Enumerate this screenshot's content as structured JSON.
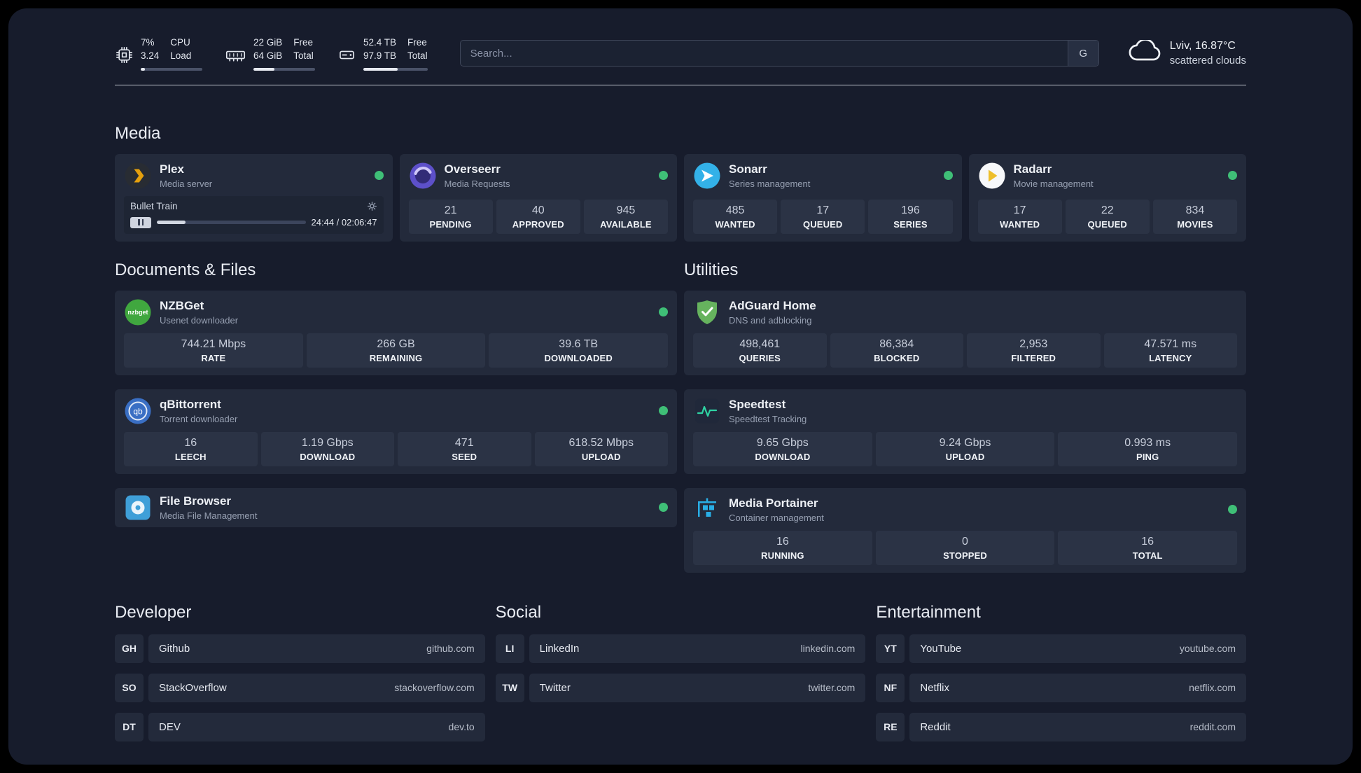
{
  "colors": {
    "status_online": "#3fbf77",
    "app_background": "#171c2c",
    "card_background": "#232a3b"
  },
  "topbar": {
    "cpu": {
      "icon": "cpu-icon",
      "value_line1": "7%",
      "value_line2": "3.24",
      "label_line1": "CPU",
      "label_line2": "Load",
      "bar_percent": 7
    },
    "memory": {
      "icon": "ram-icon",
      "value_line1": "22 GiB",
      "value_line2": "64 GiB",
      "label_line1": "Free",
      "label_line2": "Total",
      "bar_percent": 34
    },
    "storage": {
      "icon": "disk-icon",
      "value_line1": "52.4 TB",
      "value_line2": "97.9 TB",
      "label_line1": "Free",
      "label_line2": "Total",
      "bar_percent": 54
    },
    "search": {
      "placeholder": "Search...",
      "button_label": "G"
    },
    "weather": {
      "icon": "cloud-icon",
      "location": "Lviv, 16.87°C",
      "condition": "scattered clouds"
    }
  },
  "sections": {
    "media": "Media",
    "documents": "Documents & Files",
    "utilities": "Utilities",
    "developer": "Developer",
    "social": "Social",
    "entertainment": "Entertainment"
  },
  "apps": {
    "plex": {
      "name": "Plex",
      "desc": "Media server",
      "icon": "plex-icon",
      "status": "online",
      "player": {
        "track": "Bullet Train",
        "time": "24:44 / 02:06:47",
        "progress_percent": 19.5,
        "pause_icon": "pause-icon",
        "settings_icon": "gear-icon"
      }
    },
    "overseerr": {
      "name": "Overseerr",
      "desc": "Media Requests",
      "icon": "overseerr-icon",
      "status": "online",
      "stats": [
        {
          "value": "21",
          "label": "PENDING"
        },
        {
          "value": "40",
          "label": "APPROVED"
        },
        {
          "value": "945",
          "label": "AVAILABLE"
        }
      ]
    },
    "sonarr": {
      "name": "Sonarr",
      "desc": "Series management",
      "icon": "sonarr-icon",
      "status": "online",
      "stats": [
        {
          "value": "485",
          "label": "WANTED"
        },
        {
          "value": "17",
          "label": "QUEUED"
        },
        {
          "value": "196",
          "label": "SERIES"
        }
      ]
    },
    "radarr": {
      "name": "Radarr",
      "desc": "Movie management",
      "icon": "radarr-icon",
      "status": "online",
      "stats": [
        {
          "value": "17",
          "label": "WANTED"
        },
        {
          "value": "22",
          "label": "QUEUED"
        },
        {
          "value": "834",
          "label": "MOVIES"
        }
      ]
    },
    "nzbget": {
      "name": "NZBGet",
      "desc": "Usenet downloader",
      "icon": "nzbget-icon",
      "status": "online",
      "stats": [
        {
          "value": "744.21 Mbps",
          "label": "RATE"
        },
        {
          "value": "266 GB",
          "label": "REMAINING"
        },
        {
          "value": "39.6 TB",
          "label": "DOWNLOADED"
        }
      ]
    },
    "qbittorrent": {
      "name": "qBittorrent",
      "desc": "Torrent downloader",
      "icon": "qbittorrent-icon",
      "status": "online",
      "stats": [
        {
          "value": "16",
          "label": "LEECH"
        },
        {
          "value": "1.19 Gbps",
          "label": "DOWNLOAD"
        },
        {
          "value": "471",
          "label": "SEED"
        },
        {
          "value": "618.52 Mbps",
          "label": "UPLOAD"
        }
      ]
    },
    "filebrowser": {
      "name": "File Browser",
      "desc": "Media File Management",
      "icon": "filebrowser-icon",
      "status": "online"
    },
    "adguard": {
      "name": "AdGuard Home",
      "desc": "DNS and adblocking",
      "icon": "adguard-icon",
      "stats": [
        {
          "value": "498,461",
          "label": "QUERIES"
        },
        {
          "value": "86,384",
          "label": "BLOCKED"
        },
        {
          "value": "2,953",
          "label": "FILTERED"
        },
        {
          "value": "47.571 ms",
          "label": "LATENCY"
        }
      ]
    },
    "speedtest": {
      "name": "Speedtest",
      "desc": "Speedtest Tracking",
      "icon": "speedtest-icon",
      "stats": [
        {
          "value": "9.65 Gbps",
          "label": "DOWNLOAD"
        },
        {
          "value": "9.24 Gbps",
          "label": "UPLOAD"
        },
        {
          "value": "0.993 ms",
          "label": "PING"
        }
      ]
    },
    "portainer": {
      "name": "Media Portainer",
      "desc": "Container management",
      "icon": "portainer-icon",
      "status": "online",
      "stats": [
        {
          "value": "16",
          "label": "RUNNING"
        },
        {
          "value": "0",
          "label": "STOPPED"
        },
        {
          "value": "16",
          "label": "TOTAL"
        }
      ]
    }
  },
  "bookmarks": {
    "developer": [
      {
        "abbr": "GH",
        "name": "Github",
        "url": "github.com"
      },
      {
        "abbr": "SO",
        "name": "StackOverflow",
        "url": "stackoverflow.com"
      },
      {
        "abbr": "DT",
        "name": "DEV",
        "url": "dev.to"
      }
    ],
    "social": [
      {
        "abbr": "LI",
        "name": "LinkedIn",
        "url": "linkedin.com"
      },
      {
        "abbr": "TW",
        "name": "Twitter",
        "url": "twitter.com"
      }
    ],
    "entertainment": [
      {
        "abbr": "YT",
        "name": "YouTube",
        "url": "youtube.com"
      },
      {
        "abbr": "NF",
        "name": "Netflix",
        "url": "netflix.com"
      },
      {
        "abbr": "RE",
        "name": "Reddit",
        "url": "reddit.com"
      }
    ]
  }
}
